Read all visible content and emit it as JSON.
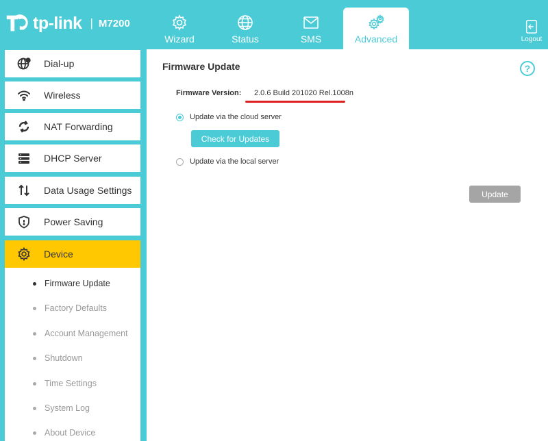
{
  "brand": {
    "name": "tp-link",
    "separator": "|",
    "model": "M7200"
  },
  "nav": {
    "tabs": [
      {
        "label": "Wizard",
        "icon": "gear-icon"
      },
      {
        "label": "Status",
        "icon": "globe-icon"
      },
      {
        "label": "SMS",
        "icon": "envelope-icon"
      },
      {
        "label": "Advanced",
        "icon": "gears-icon"
      }
    ],
    "logout": "Logout"
  },
  "sidebar": {
    "items": [
      {
        "label": "Dial-up",
        "icon": "globe-gear-icon"
      },
      {
        "label": "Wireless",
        "icon": "wifi-icon"
      },
      {
        "label": "NAT Forwarding",
        "icon": "refresh-icon"
      },
      {
        "label": "DHCP Server",
        "icon": "server-icon"
      },
      {
        "label": "Data Usage Settings",
        "icon": "up-down-arrows-icon"
      },
      {
        "label": "Power Saving",
        "icon": "shield-icon"
      },
      {
        "label": "Device",
        "icon": "gear-icon"
      }
    ],
    "sub_items": [
      "Firmware Update",
      "Factory Defaults",
      "Account Management",
      "Shutdown",
      "Time Settings",
      "System Log",
      "About Device"
    ]
  },
  "main": {
    "title": "Firmware Update",
    "help": "?",
    "fw_label": "Firmware Version:",
    "fw_value": "2.0.6 Build 201020 Rel.1008n",
    "radio_cloud": "Update via the cloud server",
    "check_button": "Check for Updates",
    "radio_local": "Update via the local server",
    "update_button": "Update"
  },
  "colors": {
    "accent": "#4acbd6",
    "active_menu": "#ffc800",
    "underline": "#e0201f",
    "disabled": "#a5a5a5"
  }
}
